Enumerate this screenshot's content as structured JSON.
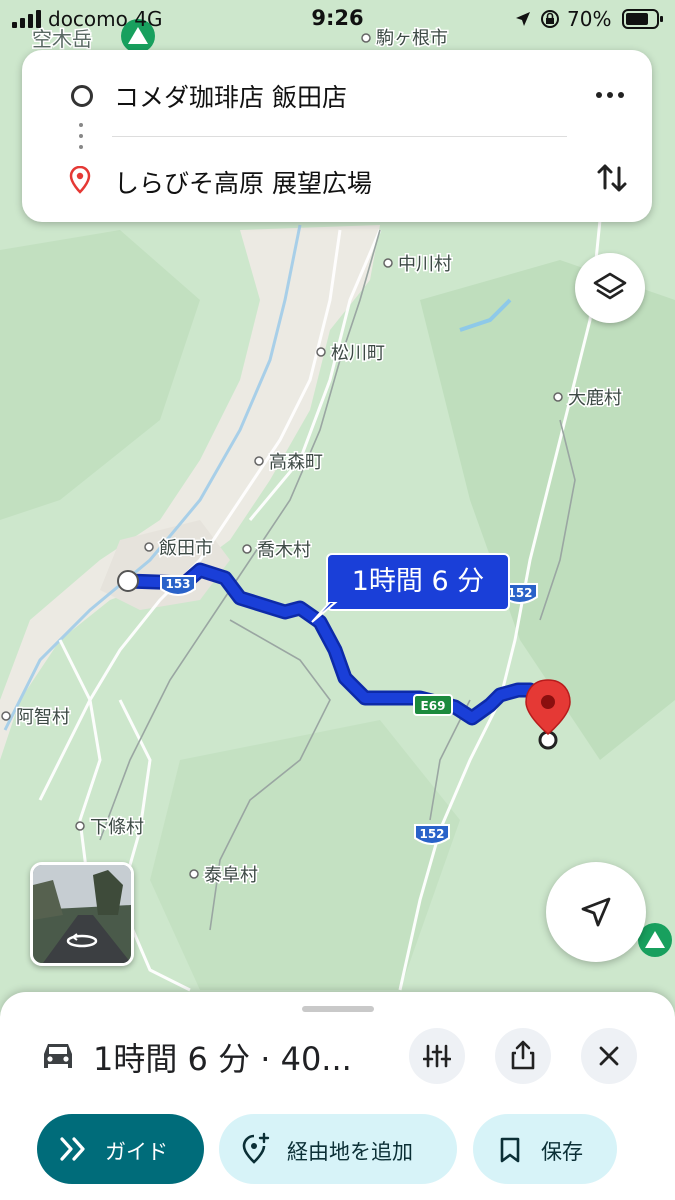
{
  "status_bar": {
    "carrier": "docomo  4G",
    "time": "9:26",
    "battery": "70%"
  },
  "directions": {
    "origin": "コメダ珈琲店 飯田店",
    "destination": "しらびそ高原 展望広場"
  },
  "map": {
    "places": {
      "utsugi": "空木岳",
      "komagane": "駒ヶ根市",
      "nakagawa": "中川村",
      "matsukawa": "松川町",
      "oshika": "大鹿村",
      "takamori": "高森町",
      "iida": "飯田市",
      "takagi": "喬木村",
      "achi": "阿智村",
      "shimojo": "下條村",
      "yasuoka": "泰阜村"
    },
    "route_shields": {
      "r153": "153",
      "r152_top": "152",
      "e69": "E69",
      "r152_bottom": "152"
    },
    "route_duration": "1時間 6 分"
  },
  "sheet": {
    "summary": "1時間 6 分 · 40...",
    "guide_label": "ガイド",
    "add_waypoint_label": "経由地を追加",
    "save_label": "保存"
  },
  "colors": {
    "route": "#1a3fd8",
    "route_outline": "#0d2aa8",
    "guide_button": "#006c7a",
    "pin": "#e53935"
  },
  "icons": [
    "signal-icon",
    "location-arrow-icon",
    "battery-icon",
    "more-icon",
    "swap-icon",
    "pin-icon",
    "layers-icon",
    "car-icon",
    "options-icon",
    "share-icon",
    "close-icon",
    "guide-icon",
    "add-waypoint-icon",
    "bookmark-icon",
    "navigate-icon",
    "mountain-icon",
    "rotate-icon"
  ]
}
